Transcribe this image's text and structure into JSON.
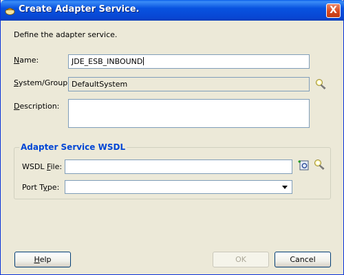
{
  "window": {
    "title": "Create Adapter Service.",
    "close_label": "X"
  },
  "intro_text": "Define the adapter service.",
  "form": {
    "name_label": "Name:",
    "name_mnemonic": "N",
    "name_rest": "ame:",
    "name_value": "JDE_ESB_INBOUND",
    "system_label": "System/Group:",
    "system_mnemonic": "S",
    "system_rest": "ystem/Group:",
    "system_value": "DefaultSystem",
    "description_label": "Description:",
    "description_mnemonic": "D",
    "description_rest": "escription:",
    "description_value": ""
  },
  "wsdl_group": {
    "title": "Adapter Service WSDL",
    "wsdl_file_label_pre": "WSDL ",
    "wsdl_file_mnemonic": "F",
    "wsdl_file_label_post": "ile:",
    "wsdl_file_value": "",
    "port_type_label_pre": "Port T",
    "port_type_mnemonic": "y",
    "port_type_label_post": "pe:",
    "port_type_value": ""
  },
  "buttons": {
    "help_mnemonic": "H",
    "help_rest": "elp",
    "ok": "OK",
    "cancel": "Cancel"
  },
  "icons": {
    "title": "adapter-icon",
    "system_browse": "flashlight-icon",
    "wsdl_create": "new-wsdl-icon",
    "wsdl_browse": "flashlight-icon"
  }
}
